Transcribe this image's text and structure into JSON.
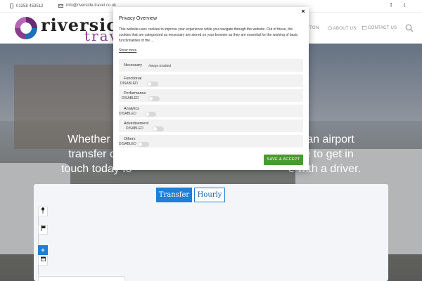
{
  "topbar": {
    "phone": "01258 453512",
    "email": "info@riverside-travel.co.uk",
    "social": [
      "f",
      "t"
    ]
  },
  "header": {
    "logo_word1": "riversic",
    "logo_word2": "trav",
    "nav": [
      "TON",
      "ABOUT US",
      "CONTACT US"
    ]
  },
  "hero": {
    "headline_line1": "Whether you'r                                              port, an airport",
    "headline_line2": "transfer or an                                                  tate to get in",
    "headline_line3": "touch today fo                                                  e with a driver."
  },
  "booking": {
    "tabs": [
      "Transfer",
      "Hourly"
    ],
    "plus": "+",
    "bottom_text": "..."
  },
  "modal": {
    "title": "Privacy Overview",
    "close": "×",
    "body": "This website uses cookies to improve your experience while you navigate through the website. Out of these, the cookies that are categorized as necessary are stored on your browser as they are essential for the working of basic functionalities of the ...",
    "show_more": "Show more",
    "categories": [
      {
        "label": "Necessary",
        "status": "Always Enabled"
      },
      {
        "label": "Functional",
        "status": "DISABLED"
      },
      {
        "label": "Performance",
        "status": "DISABLED"
      },
      {
        "label": "Analytics",
        "status": "DISABLED"
      },
      {
        "label": "Advertisement",
        "status": "DISABLED"
      },
      {
        "label": "Others",
        "status": "DISABLED"
      }
    ],
    "save_button": "SAVE & ACCEPT"
  },
  "colors": {
    "accent_blue": "#1e7fd8",
    "save_green": "#4a9a2f",
    "brand_purple": "#8a3d8f"
  }
}
